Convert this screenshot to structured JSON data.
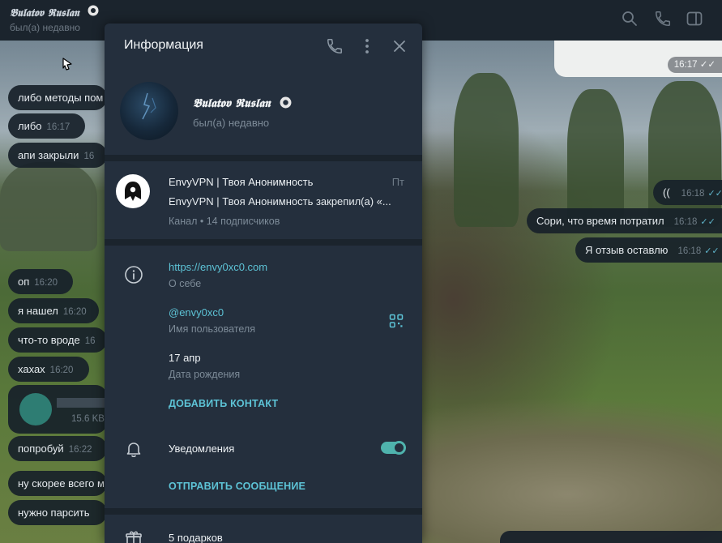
{
  "header": {
    "name": "𝕭𝖚𝖑𝖆𝖙𝖔𝖛 𝕽𝖚𝖘𝖑𝖆𝖓",
    "status": "был(а) недавно",
    "icons": [
      "search-icon",
      "phone-icon",
      "sidebar-toggle-icon"
    ]
  },
  "chat": {
    "outgoing_top_time": "16:17",
    "incoming": [
      {
        "text": "либо методы пом",
        "time": ""
      },
      {
        "text": "либо",
        "time": "16:17"
      },
      {
        "text": "апи закрыли",
        "time": "16"
      },
      {
        "text": "оп",
        "time": "16:20"
      },
      {
        "text": "я нашел",
        "time": "16:20"
      },
      {
        "text": "что-то вроде",
        "time": "16"
      },
      {
        "text": "хахах",
        "time": "16:20"
      },
      {
        "text": "попробуй",
        "time": "16:22"
      },
      {
        "text": "ну скорее всего м",
        "time": ""
      },
      {
        "text": "нужно парсить",
        "time": ""
      }
    ],
    "file": {
      "size": "15.6 KB"
    },
    "outgoing": [
      {
        "text": "((",
        "time": "16:18"
      },
      {
        "text": "Сори, что время потратил",
        "time": "16:18"
      },
      {
        "text": "Я отзыв оставлю",
        "time": "16:18"
      }
    ]
  },
  "panel": {
    "title": "Информация",
    "profile": {
      "name": "𝕭𝖚𝖑𝖆𝖙𝖔𝖛 𝕽𝖚𝖘𝖑𝖆𝖓",
      "status": "был(а) недавно"
    },
    "channel": {
      "title": "EnvyVPN | Твоя Анонимность",
      "date": "Пт",
      "pinned": "EnvyVPN | Твоя Анонимность закрепил(а) «...",
      "meta": "Канал • 14 подписчиков"
    },
    "bio": {
      "value": "https://envy0xc0.com",
      "label": "О себе"
    },
    "username": {
      "value": "@envy0xc0",
      "label": "Имя пользователя"
    },
    "birthday": {
      "value": "17 апр",
      "label": "Дата рождения"
    },
    "add_contact": "ДОБАВИТЬ КОНТАКТ",
    "notifications": {
      "label": "Уведомления",
      "enabled": true
    },
    "send_message": "ОТПРАВИТЬ СООБЩЕНИЕ",
    "gifts": "5 подарков"
  },
  "colors": {
    "accent": "#5dc3d6",
    "panel_bg": "#242f3d",
    "toggle": "#4fb3ad"
  }
}
